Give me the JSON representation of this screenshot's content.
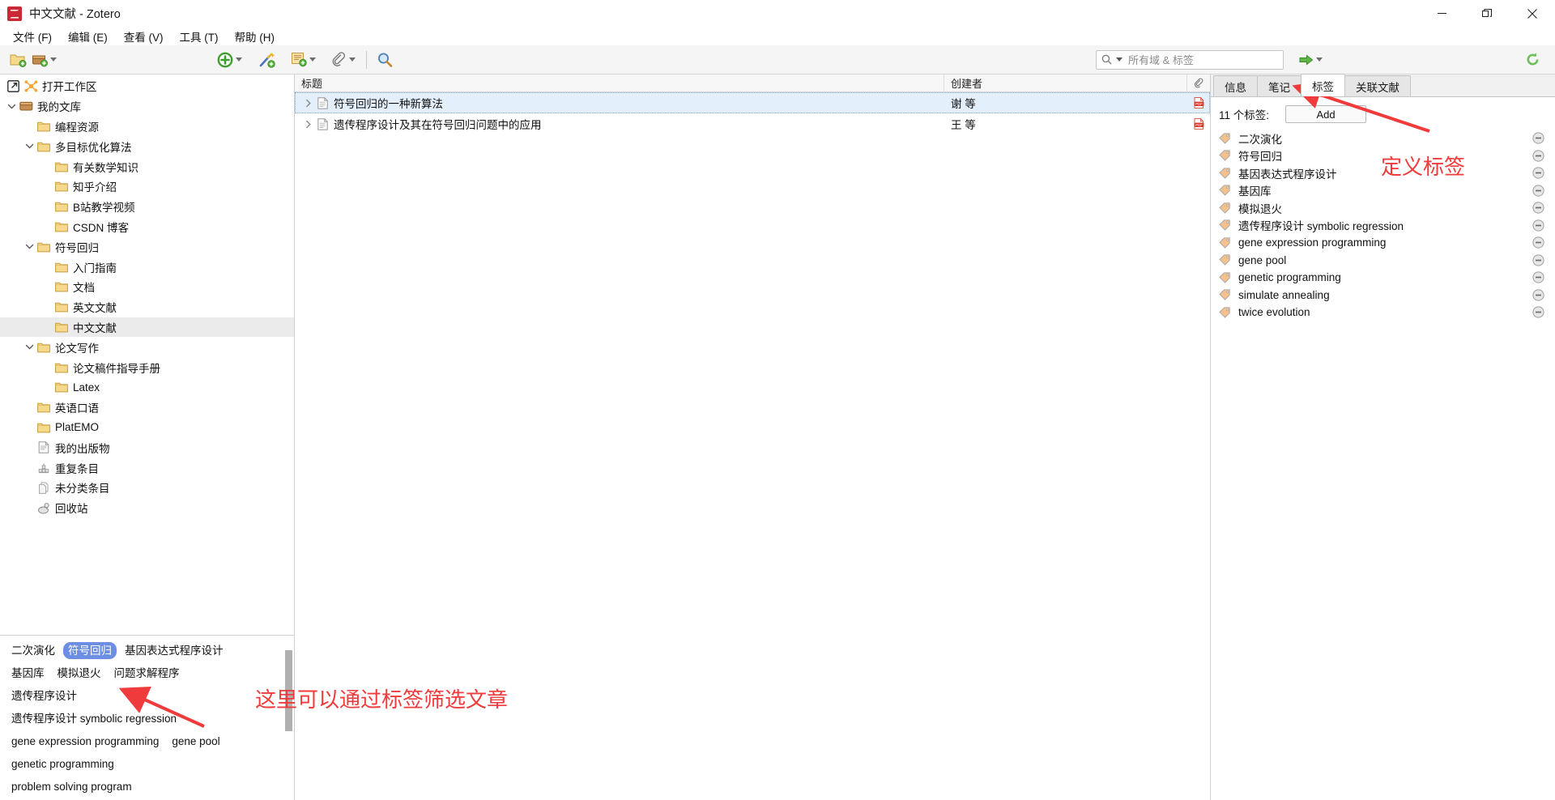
{
  "window": {
    "title": "中文文献 - Zotero",
    "logo_icon": "zotero-logo-icon",
    "minimize_label": "—",
    "restore_label": "restore",
    "close_label": "✕"
  },
  "menubar": {
    "items": [
      {
        "label": "文件 (F)",
        "name": "menu-file"
      },
      {
        "label": "编辑 (E)",
        "name": "menu-edit"
      },
      {
        "label": "查看 (V)",
        "name": "menu-view"
      },
      {
        "label": "工具 (T)",
        "name": "menu-tools"
      },
      {
        "label": "帮助 (H)",
        "name": "menu-help"
      }
    ]
  },
  "toolbar": {
    "new_collection_icon": "new-collection-folder-icon",
    "new_library_icon": "new-library-box-icon",
    "add_item_icon": "add-item-plus-icon",
    "magic_wand_icon": "magic-wand-add-by-identifier-icon",
    "new_note_icon": "new-note-icon",
    "attachment_icon": "add-attachment-paperclip-icon",
    "advanced_search_icon": "advanced-search-magnifier-icon",
    "sync_icon": "sync-arrow-icon",
    "locate_icon": "locate-green-arrow-icon"
  },
  "search": {
    "placeholder": "所有域 & 标签",
    "value": "",
    "search_icon": "search-magnifier-icon",
    "dropdown_icon": "chevron-down-icon"
  },
  "collections": {
    "open_workspace": {
      "label": "打开工作区",
      "icon": "open-workspace-icon"
    },
    "items": [
      {
        "label": "我的文库",
        "depth": 0,
        "icon": "library-box-icon",
        "twisty": "open",
        "selected": false
      },
      {
        "label": "编程资源",
        "depth": 1,
        "icon": "folder-icon",
        "twisty": "none",
        "selected": false
      },
      {
        "label": "多目标优化算法",
        "depth": 1,
        "icon": "folder-icon",
        "twisty": "open",
        "selected": false
      },
      {
        "label": "有关数学知识",
        "depth": 2,
        "icon": "folder-icon",
        "twisty": "none",
        "selected": false
      },
      {
        "label": "知乎介绍",
        "depth": 2,
        "icon": "folder-icon",
        "twisty": "none",
        "selected": false
      },
      {
        "label": "B站教学视频",
        "depth": 2,
        "icon": "folder-icon",
        "twisty": "none",
        "selected": false
      },
      {
        "label": "CSDN 博客",
        "depth": 2,
        "icon": "folder-icon",
        "twisty": "none",
        "selected": false
      },
      {
        "label": "符号回归",
        "depth": 1,
        "icon": "folder-icon",
        "twisty": "open",
        "selected": false
      },
      {
        "label": "入门指南",
        "depth": 2,
        "icon": "folder-icon",
        "twisty": "none",
        "selected": false
      },
      {
        "label": "文档",
        "depth": 2,
        "icon": "folder-icon",
        "twisty": "none",
        "selected": false
      },
      {
        "label": "英文文献",
        "depth": 2,
        "icon": "folder-icon",
        "twisty": "none",
        "selected": false
      },
      {
        "label": "中文文献",
        "depth": 2,
        "icon": "folder-icon",
        "twisty": "none",
        "selected": true
      },
      {
        "label": "论文写作",
        "depth": 1,
        "icon": "folder-icon",
        "twisty": "open",
        "selected": false
      },
      {
        "label": "论文稿件指导手册",
        "depth": 2,
        "icon": "folder-icon",
        "twisty": "none",
        "selected": false
      },
      {
        "label": "Latex",
        "depth": 2,
        "icon": "folder-icon",
        "twisty": "none",
        "selected": false
      },
      {
        "label": "英语口语",
        "depth": 1,
        "icon": "folder-icon",
        "twisty": "none",
        "selected": false
      },
      {
        "label": "PlatEMO",
        "depth": 1,
        "icon": "folder-icon",
        "twisty": "none",
        "selected": false
      },
      {
        "label": "我的出版物",
        "depth": 1,
        "icon": "my-publications-icon",
        "twisty": "none",
        "selected": false
      },
      {
        "label": "重复条目",
        "depth": 1,
        "icon": "duplicate-items-icon",
        "twisty": "none",
        "selected": false
      },
      {
        "label": "未分类条目",
        "depth": 1,
        "icon": "unfiled-items-icon",
        "twisty": "none",
        "selected": false
      },
      {
        "label": "回收站",
        "depth": 1,
        "icon": "trash-icon",
        "twisty": "none",
        "selected": false
      }
    ]
  },
  "tag_selector": {
    "scrollbar": "vertical-scrollbar",
    "tags": [
      {
        "label": "二次演化",
        "selected": false
      },
      {
        "label": "符号回归",
        "selected": true
      },
      {
        "label": "基因表达式程序设计",
        "selected": false
      },
      {
        "label": "基因库",
        "selected": false
      },
      {
        "label": "模拟退火",
        "selected": false
      },
      {
        "label": "问题求解程序",
        "selected": false
      },
      {
        "label": "遗传程序设计",
        "selected": false
      },
      {
        "label": "遗传程序设计 symbolic regression",
        "selected": false
      },
      {
        "label": "gene expression programming",
        "selected": false
      },
      {
        "label": "gene pool",
        "selected": false
      },
      {
        "label": "genetic programming",
        "selected": false
      },
      {
        "label": "problem solving program",
        "selected": false
      }
    ]
  },
  "items": {
    "columns": {
      "title": "标题",
      "creator": "创建者",
      "attachment_icon": "paperclip-column-icon"
    },
    "rows": [
      {
        "title": "符号回归的一种新算法",
        "creator": "谢 等",
        "selected": true,
        "item_icon": "document-icon",
        "attachment": "pdf-icon",
        "twisty": "closed"
      },
      {
        "title": "遗传程序设计及其在符号回归问题中的应用",
        "creator": "王 等",
        "selected": false,
        "item_icon": "document-icon",
        "attachment": "pdf-icon",
        "twisty": "closed"
      }
    ]
  },
  "right_panel": {
    "tabs": [
      {
        "label": "信息",
        "active": false,
        "name": "tab-info"
      },
      {
        "label": "笔记",
        "active": false,
        "name": "tab-notes"
      },
      {
        "label": "标签",
        "active": true,
        "name": "tab-tags"
      },
      {
        "label": "关联文献",
        "active": false,
        "name": "tab-related"
      }
    ],
    "tag_count_label": "11 个标签:",
    "add_button_label": "Add",
    "tags": [
      {
        "label": "二次演化"
      },
      {
        "label": "符号回归"
      },
      {
        "label": "基因表达式程序设计"
      },
      {
        "label": "基因库"
      },
      {
        "label": "模拟退火"
      },
      {
        "label": "遗传程序设计 symbolic regression"
      },
      {
        "label": "gene expression programming"
      },
      {
        "label": "gene pool"
      },
      {
        "label": "genetic programming"
      },
      {
        "label": "simulate annealing"
      },
      {
        "label": "twice evolution"
      }
    ],
    "tag_icon": "tag-icon",
    "remove_icon": "remove-minus-icon"
  },
  "annotations": {
    "color": "#ef3b3b",
    "define_tags": "定义标签",
    "filter_by_tags": "这里可以通过标签筛选文章"
  }
}
